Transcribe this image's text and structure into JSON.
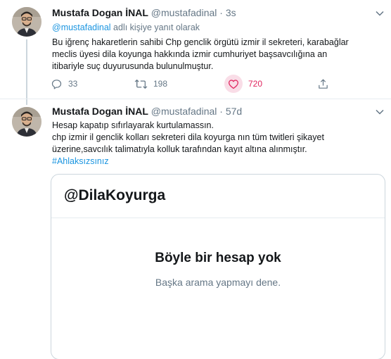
{
  "tweet1": {
    "name": "Mustafa Dogan İNAL",
    "handle": "@mustafadinal",
    "separator": "·",
    "date": "3s",
    "reply_handle": "@mustafadinal",
    "reply_suffix": " adlı kişiye yanıt olarak",
    "lines": [
      "Bu iğrenç hakaretlerin sahibi Chp genclik örgütü izmir il sekreteri, karabağlar",
      "meclis üyesi dila koyunga hakkında izmir cumhuriyet başsavcılığına an",
      "itibariyle suç duyurusunda bulunulmuştur."
    ],
    "actions": {
      "reply_icon": "reply-icon",
      "reply_count": "33",
      "retweet_icon": "retweet-icon",
      "retweet_count": "198",
      "like_icon": "heart-icon",
      "like_count": "720",
      "share_icon": "share-icon"
    }
  },
  "tweet2": {
    "name": "Mustafa Dogan İNAL",
    "handle": "@mustafadinal",
    "separator": "·",
    "date": "57d",
    "lines": [
      "Hesap kapatıp sıfırlayarak kurtulamassın.",
      "chp izmir il genclik kolları sekreteri dila koyurga nın tüm twitleri şikayet",
      "üzerine,savcılık talimatıyla kolluk tarafından kayıt altına alınmıştır."
    ],
    "hashtag": "#Ahlaksızsınız"
  },
  "card": {
    "title": "@DilaKoyurga",
    "heading": "Böyle bir hesap yok",
    "subtext": "Başka arama yapmayı dene."
  },
  "colors": {
    "link": "#1b95e0",
    "muted": "#657786",
    "like": "#e0245e",
    "like_bg": "#f9dde7",
    "border": "#ccd6dd"
  }
}
